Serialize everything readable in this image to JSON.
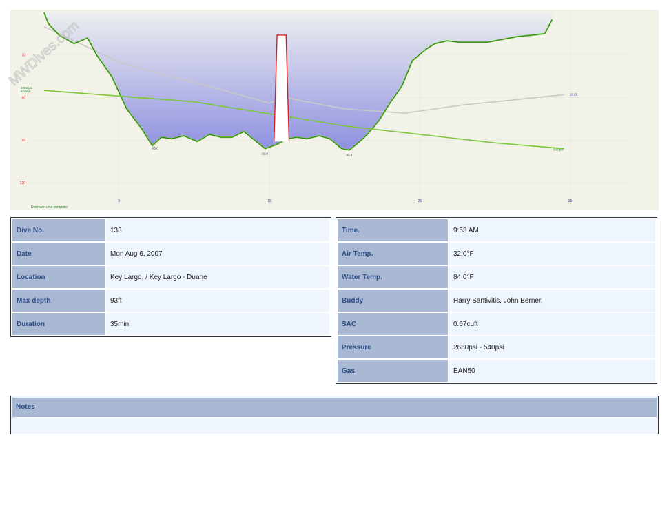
{
  "watermark": "MWDives.com",
  "chart_data": {
    "type": "area",
    "computer_label": "Unknown dive computer",
    "x_ticks": [
      5,
      15,
      25,
      35
    ],
    "y_ticks": [
      30,
      60,
      90,
      120
    ],
    "xlim": [
      -1,
      39
    ],
    "ylim": [
      0,
      138
    ],
    "y_inverted": true,
    "grid": true,
    "depth_annotations": [
      {
        "t": 7.4,
        "label": "85.0"
      },
      {
        "t": 14.7,
        "label": "92.0"
      },
      {
        "t": 20.3,
        "label": "92.0"
      }
    ],
    "depth_profile": {
      "t": [
        0,
        0.3,
        1.0,
        2.0,
        2.9,
        3.5,
        4.5,
        5.5,
        6.5,
        7.2,
        7.8,
        8.5,
        9.3,
        10.2,
        11.0,
        11.8,
        12.5,
        13.3,
        14.0,
        14.7,
        15.5,
        16.2,
        16.8,
        17.5,
        18.3,
        19.0,
        19.8,
        20.3,
        20.9,
        21.5,
        22.3,
        23.0,
        23.8,
        24.5,
        25.4,
        26.0,
        26.8,
        27.6,
        28.5,
        29.5,
        30.5,
        31.5,
        32.5,
        33.3,
        33.8
      ],
      "depth": [
        0,
        8,
        16,
        22,
        18,
        30,
        45,
        68,
        82,
        94,
        88,
        89,
        87,
        91,
        86,
        88,
        88,
        84,
        90,
        96,
        93,
        89,
        88,
        89,
        87,
        89,
        96,
        97,
        92,
        86,
        76,
        64,
        52,
        34,
        26,
        22,
        20,
        21,
        21,
        21,
        19,
        17,
        16,
        15,
        5
      ]
    },
    "pressure_start": {
      "label": "2660 psi",
      "gas": "EAN50"
    },
    "pressure_end": {
      "label": "540 psi"
    },
    "pressure_line": {
      "t": [
        0,
        10,
        20,
        30,
        34.6
      ],
      "depth": [
        55,
        63,
        80,
        92,
        96
      ]
    },
    "temperature_line": {
      "t": [
        0,
        2,
        5,
        8,
        12,
        15,
        16,
        20,
        24,
        28,
        30,
        34.6
      ],
      "depth": [
        10,
        20,
        35,
        44,
        55,
        64,
        60,
        68,
        71,
        65,
        63,
        58
      ],
      "end_label": "18.58"
    },
    "ceiling_spike": {
      "t": [
        15.3,
        15.5,
        16.1,
        16.3
      ],
      "depth": [
        91,
        16,
        16,
        91
      ],
      "label": "101.6"
    },
    "colors": {
      "fill_top": "#eceef0",
      "fill_bottom": "#8f90e0",
      "bg": "#f2f2e9",
      "profile": "#7fcc3a",
      "profile_dark": "#176c1c",
      "pressure": "#7cc63a",
      "temperature": "#c8c8c8",
      "spike": "#e01818",
      "depth_tick": "#d43030",
      "time_tick": "#2e3da8"
    }
  },
  "dive": {
    "rows_left": [
      {
        "key": "Dive No.",
        "value": "133"
      },
      {
        "key": "Date",
        "value": "Mon Aug 6, 2007"
      },
      {
        "key": "Location",
        "value": "Key Largo, / Key Largo - Duane"
      },
      {
        "key": "Max depth",
        "value": "93ft"
      },
      {
        "key": "Duration",
        "value": "35min"
      }
    ],
    "rows_right": [
      {
        "key": "Time.",
        "value": "9:53 AM"
      },
      {
        "key": "Air Temp.",
        "value": "32.0°F"
      },
      {
        "key": "Water Temp.",
        "value": "84.0°F"
      },
      {
        "key": "Buddy",
        "value": "Harry Santivitis, John Berner,"
      },
      {
        "key": "SAC",
        "value": "0.67cuft"
      },
      {
        "key": "Pressure",
        "value": "2660psi - 540psi"
      },
      {
        "key": "Gas",
        "value": "EAN50"
      }
    ],
    "notes_label": "Notes",
    "notes_text": ""
  }
}
